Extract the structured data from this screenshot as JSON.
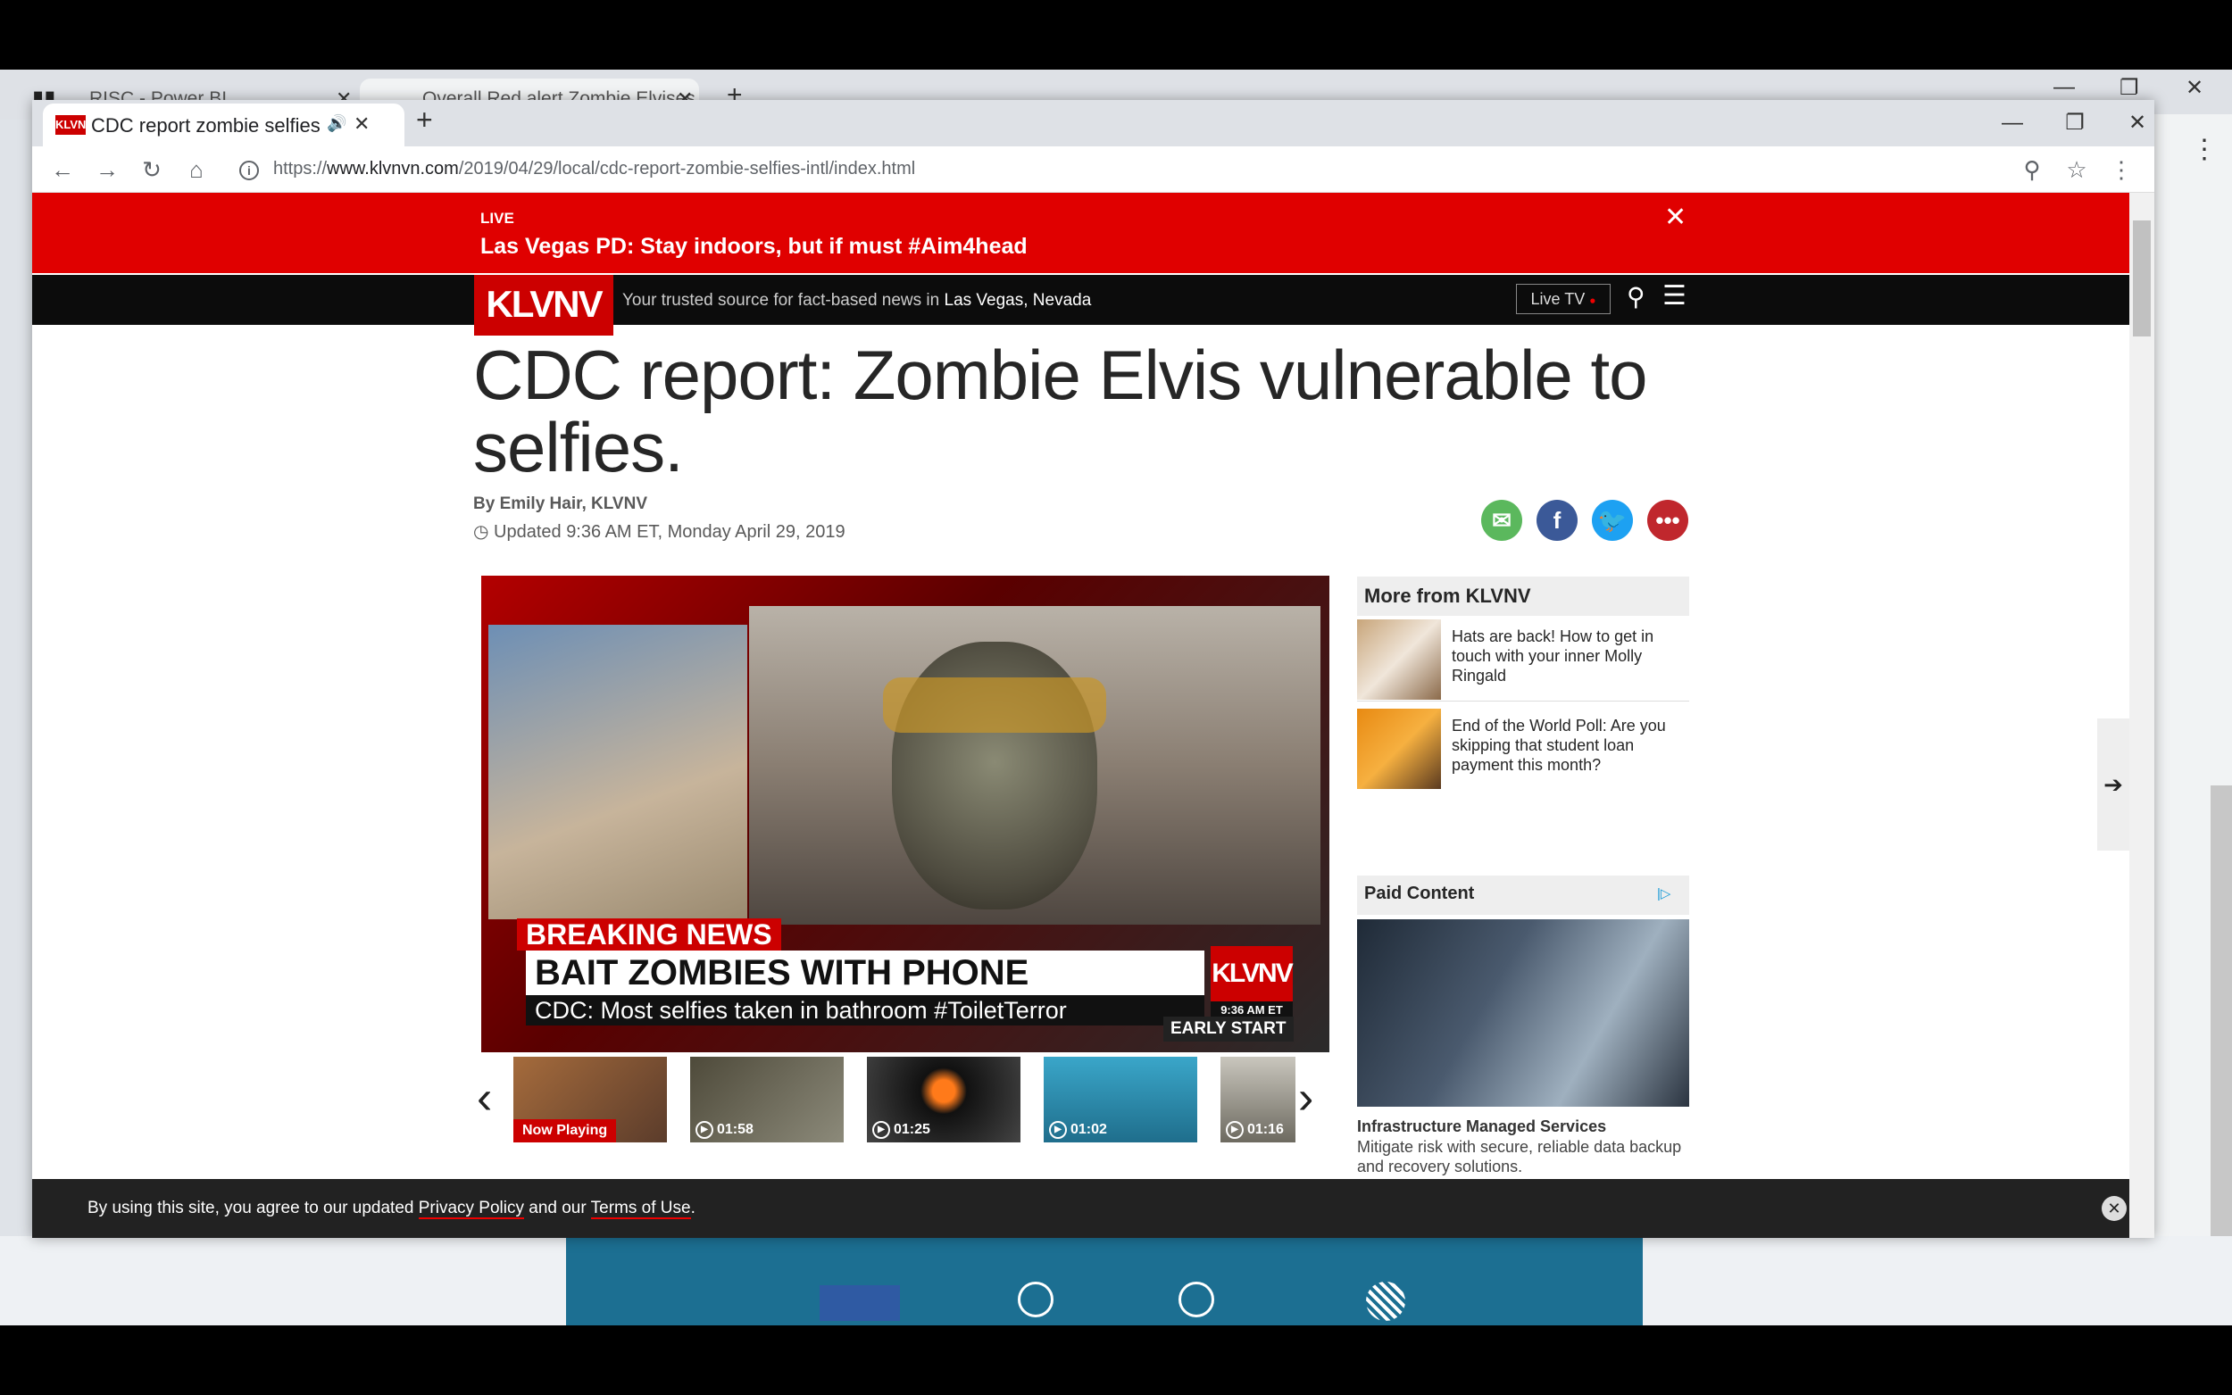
{
  "background_window": {
    "tabs": [
      {
        "label": "RISC - Power BI"
      },
      {
        "label": "Overall Red alert Zombie Elvises"
      }
    ]
  },
  "browser": {
    "tab_title": "CDC report zombie selfies",
    "favicon_text": "KLVNV",
    "url_prefix": "https://",
    "url_domain": "www.klvnvn.com",
    "url_path": "/2019/04/29/local/cdc-report-zombie-selfies-intl/index.html"
  },
  "live_banner": {
    "label": "LIVE",
    "headline": "Las Vegas PD: Stay indoors, but if must #Aim4head"
  },
  "nav": {
    "logo": "KLVNV",
    "tagline_prefix": "Your trusted source for fact-based news in",
    "tagline_location": "Las Vegas, Nevada",
    "live_tv": "Live TV"
  },
  "article": {
    "headline": "CDC report: Zombie Elvis vulnerable to selfies.",
    "byline": "By Emily Hair, KLVNV",
    "updated": "Updated 9:36 AM ET, Monday April 29, 2019"
  },
  "video": {
    "breaking": "BREAKING NEWS",
    "main_caption": "BAIT ZOMBIES WITH PHONE",
    "sub_caption": "CDC: Most selfies taken in bathroom #ToiletTerror",
    "logo": "KLVNV",
    "time": "9:36 AM ET",
    "show": "EARLY START",
    "playlist": [
      {
        "label": "Now Playing"
      },
      {
        "label": "01:58"
      },
      {
        "label": "01:25"
      },
      {
        "label": "01:02"
      },
      {
        "label": "01:16"
      }
    ]
  },
  "sidebar": {
    "more_header": "More from KLVNV",
    "more_items": [
      {
        "title": "Hats are back! How to get in touch with your inner Molly Ringald"
      },
      {
        "title": "End of the World Poll: Are you skipping that student loan payment this month?"
      }
    ],
    "paid_header": "Paid Content",
    "paid_title": "Infrastructure Managed Services",
    "paid_desc": "Mitigate risk with secure, reliable data backup and recovery solutions."
  },
  "cookie": {
    "text_prefix": "By using this site, you agree to our updated",
    "privacy": "Privacy Policy",
    "and": "and our",
    "terms": "Terms of Use",
    "suffix": "."
  },
  "colors": {
    "brand_red": "#cc0000",
    "live_red": "#e00000",
    "nav_black": "#0c0c0c"
  }
}
